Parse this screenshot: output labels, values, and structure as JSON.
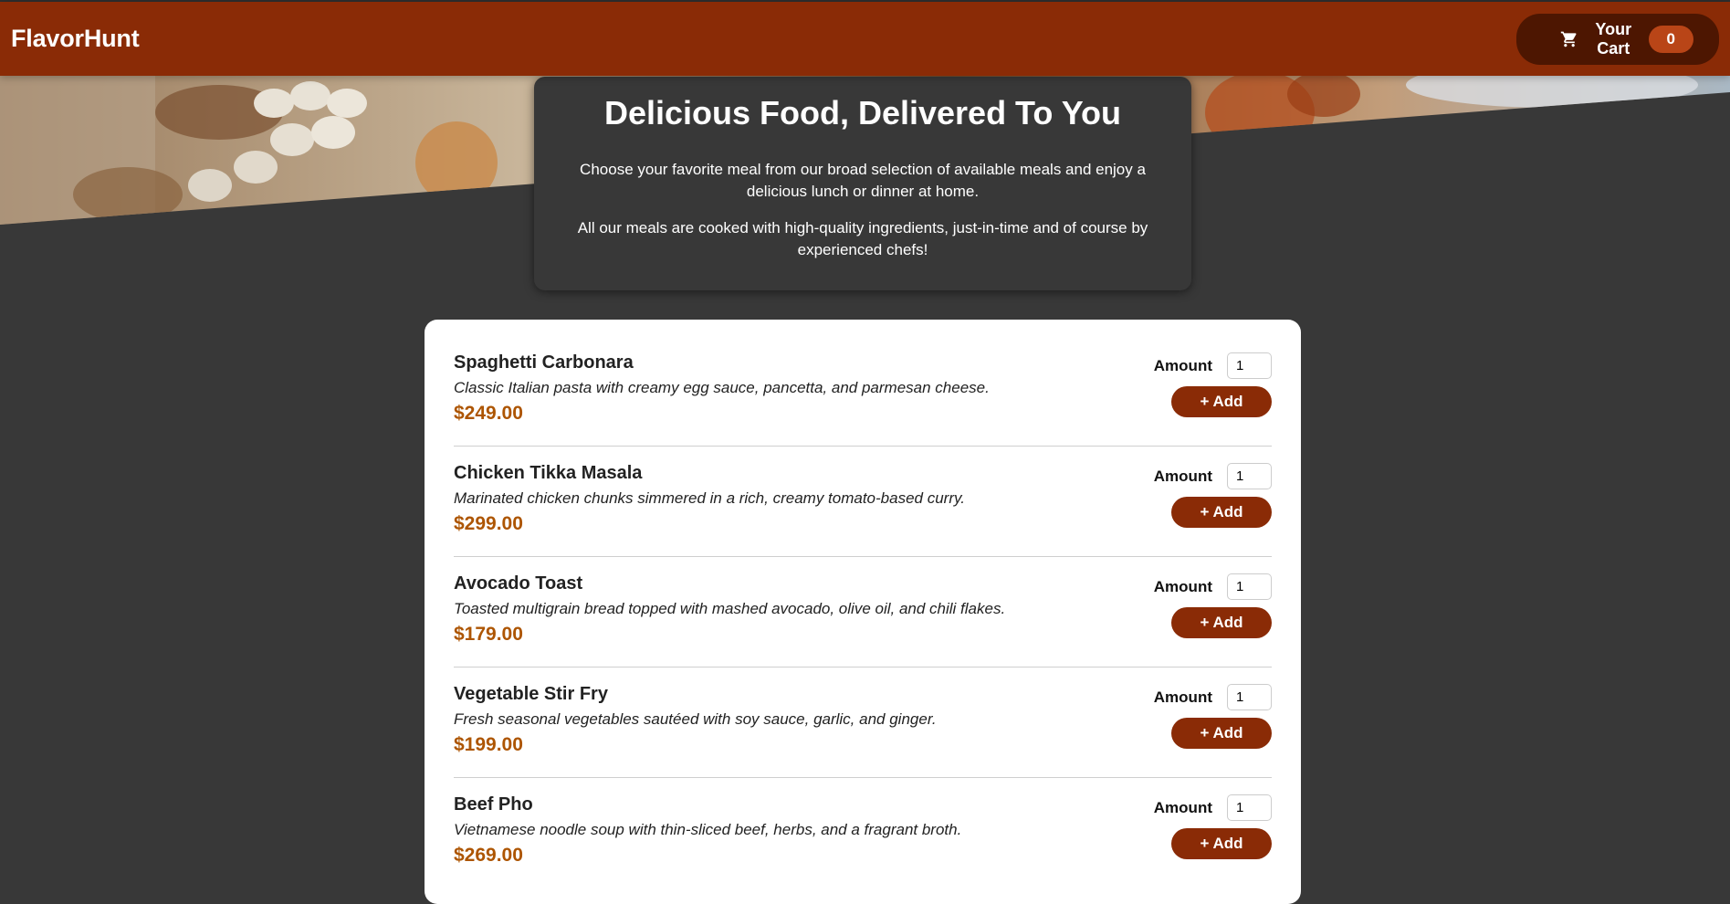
{
  "header": {
    "brand": "FlavorHunt",
    "cart": {
      "icon": "cart-icon",
      "label": "Your Cart",
      "count": "0"
    }
  },
  "colors": {
    "primary": "#8a2b06",
    "primary_dark": "#4d1601",
    "badge": "#b94517",
    "price": "#ad5502",
    "page_background": "#383838"
  },
  "summary": {
    "title": "Delicious Food, Delivered To You",
    "paragraph1": "Choose your favorite meal from our broad selection of available meals and enjoy a delicious lunch or dinner at home.",
    "paragraph2": "All our meals are cooked with high-quality ingredients, just-in-time and of course by experienced chefs!"
  },
  "form": {
    "amount_label": "Amount",
    "add_label": "+ Add"
  },
  "meals": [
    {
      "name": "Spaghetti Carbonara",
      "description": "Classic Italian pasta with creamy egg sauce, pancetta, and parmesan cheese.",
      "price": "$249.00",
      "amount": "1"
    },
    {
      "name": "Chicken Tikka Masala",
      "description": "Marinated chicken chunks simmered in a rich, creamy tomato-based curry.",
      "price": "$299.00",
      "amount": "1"
    },
    {
      "name": "Avocado Toast",
      "description": "Toasted multigrain bread topped with mashed avocado, olive oil, and chili flakes.",
      "price": "$179.00",
      "amount": "1"
    },
    {
      "name": "Vegetable Stir Fry",
      "description": "Fresh seasonal vegetables sautéed with soy sauce, garlic, and ginger.",
      "price": "$199.00",
      "amount": "1"
    },
    {
      "name": "Beef Pho",
      "description": "Vietnamese noodle soup with thin-sliced beef, herbs, and a fragrant broth.",
      "price": "$269.00",
      "amount": "1"
    }
  ]
}
